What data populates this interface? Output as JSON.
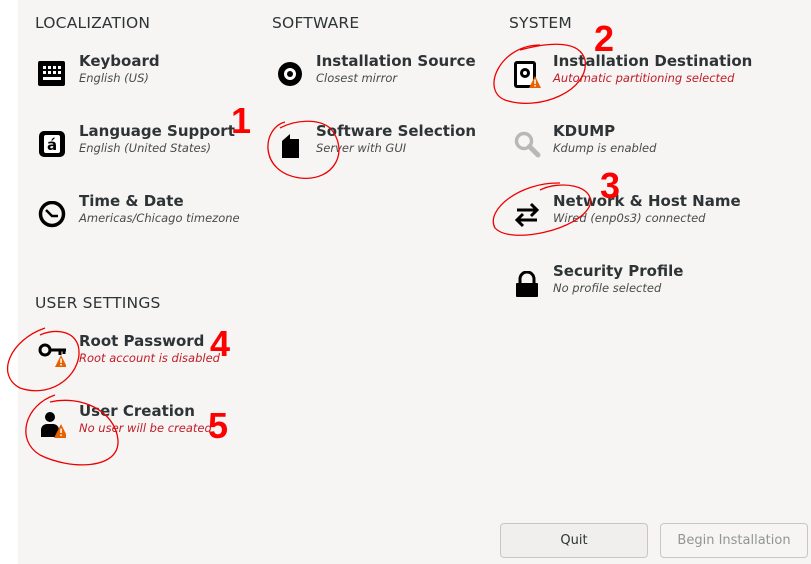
{
  "sections": {
    "localization": "LOCALIZATION",
    "software": "SOFTWARE",
    "system": "SYSTEM",
    "user_settings": "USER SETTINGS"
  },
  "spokes": {
    "keyboard": {
      "title": "Keyboard",
      "status": "English (US)",
      "icon": "keyboard-icon"
    },
    "language": {
      "title": "Language Support",
      "status": "English (United States)",
      "icon": "language-icon"
    },
    "time": {
      "title": "Time & Date",
      "status": "Americas/Chicago timezone",
      "icon": "clock-icon"
    },
    "source": {
      "title": "Installation Source",
      "status": "Closest mirror",
      "icon": "disc-icon"
    },
    "software": {
      "title": "Software Selection",
      "status": "Server with GUI",
      "icon": "package-icon"
    },
    "destination": {
      "title": "Installation Destination",
      "status": "Automatic partitioning selected",
      "icon": "harddisk-warning-icon"
    },
    "kdump": {
      "title": "KDUMP",
      "status": "Kdump is enabled",
      "icon": "search-icon"
    },
    "network": {
      "title": "Network & Host Name",
      "status": "Wired (enp0s3) connected",
      "icon": "network-arrows-icon"
    },
    "security": {
      "title": "Security Profile",
      "status": "No profile selected",
      "icon": "lock-icon"
    },
    "root": {
      "title": "Root Password",
      "status": "Root account is disabled",
      "icon": "key-warning-icon"
    },
    "user": {
      "title": "User Creation",
      "status": "No user will be created",
      "icon": "user-warning-icon"
    }
  },
  "buttons": {
    "quit": "Quit",
    "begin": "Begin Installation"
  },
  "annotations": [
    "1",
    "2",
    "3",
    "4",
    "5"
  ],
  "colors": {
    "warning_text": "#c01c28",
    "annotation": "#ff0000",
    "background": "#f6f5f4"
  }
}
